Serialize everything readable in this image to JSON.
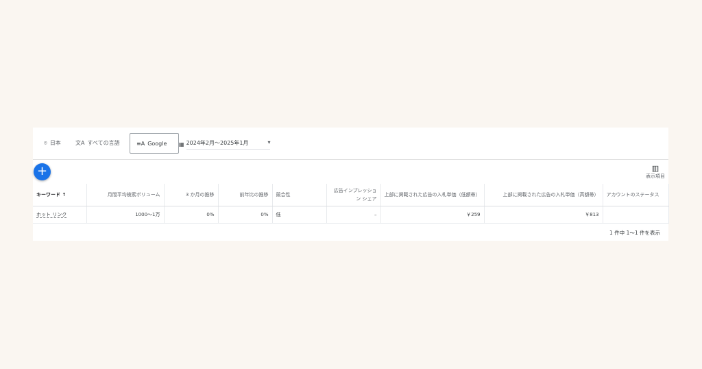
{
  "filters": {
    "location": "日本",
    "language": "すべての言語",
    "network": "Google",
    "date_range": "2024年2月～2025年1月"
  },
  "toolbar": {
    "add_label": "+",
    "columns_label": "表示項目"
  },
  "table": {
    "headers": [
      "キーワード",
      "月間平均検索ボリューム",
      "3 か月の推移",
      "前年比の推移",
      "競合性",
      "広告インプレッション シェア",
      "上部に掲載された広告の入札単価（低額帯）",
      "上部に掲載された広告の入札単価（高額帯）",
      "アカウントのステータス"
    ],
    "sort_indicator": "↑",
    "rows": [
      [
        "ホット リンク",
        "1000～1万",
        "0%",
        "0%",
        "低",
        "–",
        "￥259",
        "￥813",
        ""
      ]
    ]
  },
  "footer": {
    "pagination": "1 件中 1～1 件を表示"
  },
  "colors": {
    "accent": "#1a73e8"
  }
}
